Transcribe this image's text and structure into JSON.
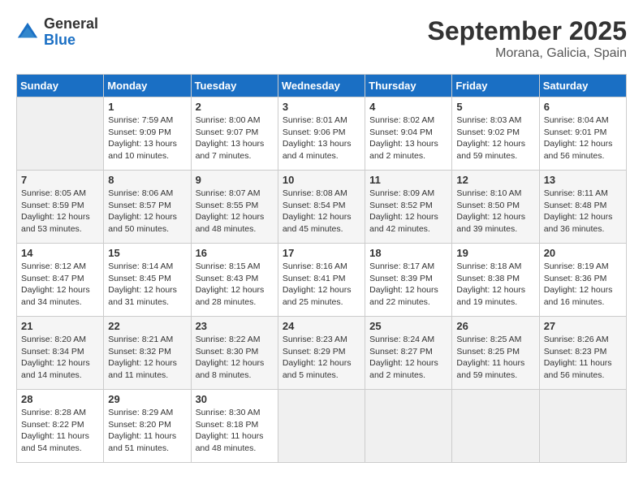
{
  "header": {
    "logo": {
      "general": "General",
      "blue": "Blue"
    },
    "title": "September 2025",
    "location": "Morana, Galicia, Spain"
  },
  "calendar": {
    "weekdays": [
      "Sunday",
      "Monday",
      "Tuesday",
      "Wednesday",
      "Thursday",
      "Friday",
      "Saturday"
    ],
    "weeks": [
      [
        {
          "day": "",
          "sunrise": "",
          "sunset": "",
          "daylight": ""
        },
        {
          "day": "1",
          "sunrise": "Sunrise: 7:59 AM",
          "sunset": "Sunset: 9:09 PM",
          "daylight": "Daylight: 13 hours and 10 minutes."
        },
        {
          "day": "2",
          "sunrise": "Sunrise: 8:00 AM",
          "sunset": "Sunset: 9:07 PM",
          "daylight": "Daylight: 13 hours and 7 minutes."
        },
        {
          "day": "3",
          "sunrise": "Sunrise: 8:01 AM",
          "sunset": "Sunset: 9:06 PM",
          "daylight": "Daylight: 13 hours and 4 minutes."
        },
        {
          "day": "4",
          "sunrise": "Sunrise: 8:02 AM",
          "sunset": "Sunset: 9:04 PM",
          "daylight": "Daylight: 13 hours and 2 minutes."
        },
        {
          "day": "5",
          "sunrise": "Sunrise: 8:03 AM",
          "sunset": "Sunset: 9:02 PM",
          "daylight": "Daylight: 12 hours and 59 minutes."
        },
        {
          "day": "6",
          "sunrise": "Sunrise: 8:04 AM",
          "sunset": "Sunset: 9:01 PM",
          "daylight": "Daylight: 12 hours and 56 minutes."
        }
      ],
      [
        {
          "day": "7",
          "sunrise": "Sunrise: 8:05 AM",
          "sunset": "Sunset: 8:59 PM",
          "daylight": "Daylight: 12 hours and 53 minutes."
        },
        {
          "day": "8",
          "sunrise": "Sunrise: 8:06 AM",
          "sunset": "Sunset: 8:57 PM",
          "daylight": "Daylight: 12 hours and 50 minutes."
        },
        {
          "day": "9",
          "sunrise": "Sunrise: 8:07 AM",
          "sunset": "Sunset: 8:55 PM",
          "daylight": "Daylight: 12 hours and 48 minutes."
        },
        {
          "day": "10",
          "sunrise": "Sunrise: 8:08 AM",
          "sunset": "Sunset: 8:54 PM",
          "daylight": "Daylight: 12 hours and 45 minutes."
        },
        {
          "day": "11",
          "sunrise": "Sunrise: 8:09 AM",
          "sunset": "Sunset: 8:52 PM",
          "daylight": "Daylight: 12 hours and 42 minutes."
        },
        {
          "day": "12",
          "sunrise": "Sunrise: 8:10 AM",
          "sunset": "Sunset: 8:50 PM",
          "daylight": "Daylight: 12 hours and 39 minutes."
        },
        {
          "day": "13",
          "sunrise": "Sunrise: 8:11 AM",
          "sunset": "Sunset: 8:48 PM",
          "daylight": "Daylight: 12 hours and 36 minutes."
        }
      ],
      [
        {
          "day": "14",
          "sunrise": "Sunrise: 8:12 AM",
          "sunset": "Sunset: 8:47 PM",
          "daylight": "Daylight: 12 hours and 34 minutes."
        },
        {
          "day": "15",
          "sunrise": "Sunrise: 8:14 AM",
          "sunset": "Sunset: 8:45 PM",
          "daylight": "Daylight: 12 hours and 31 minutes."
        },
        {
          "day": "16",
          "sunrise": "Sunrise: 8:15 AM",
          "sunset": "Sunset: 8:43 PM",
          "daylight": "Daylight: 12 hours and 28 minutes."
        },
        {
          "day": "17",
          "sunrise": "Sunrise: 8:16 AM",
          "sunset": "Sunset: 8:41 PM",
          "daylight": "Daylight: 12 hours and 25 minutes."
        },
        {
          "day": "18",
          "sunrise": "Sunrise: 8:17 AM",
          "sunset": "Sunset: 8:39 PM",
          "daylight": "Daylight: 12 hours and 22 minutes."
        },
        {
          "day": "19",
          "sunrise": "Sunrise: 8:18 AM",
          "sunset": "Sunset: 8:38 PM",
          "daylight": "Daylight: 12 hours and 19 minutes."
        },
        {
          "day": "20",
          "sunrise": "Sunrise: 8:19 AM",
          "sunset": "Sunset: 8:36 PM",
          "daylight": "Daylight: 12 hours and 16 minutes."
        }
      ],
      [
        {
          "day": "21",
          "sunrise": "Sunrise: 8:20 AM",
          "sunset": "Sunset: 8:34 PM",
          "daylight": "Daylight: 12 hours and 14 minutes."
        },
        {
          "day": "22",
          "sunrise": "Sunrise: 8:21 AM",
          "sunset": "Sunset: 8:32 PM",
          "daylight": "Daylight: 12 hours and 11 minutes."
        },
        {
          "day": "23",
          "sunrise": "Sunrise: 8:22 AM",
          "sunset": "Sunset: 8:30 PM",
          "daylight": "Daylight: 12 hours and 8 minutes."
        },
        {
          "day": "24",
          "sunrise": "Sunrise: 8:23 AM",
          "sunset": "Sunset: 8:29 PM",
          "daylight": "Daylight: 12 hours and 5 minutes."
        },
        {
          "day": "25",
          "sunrise": "Sunrise: 8:24 AM",
          "sunset": "Sunset: 8:27 PM",
          "daylight": "Daylight: 12 hours and 2 minutes."
        },
        {
          "day": "26",
          "sunrise": "Sunrise: 8:25 AM",
          "sunset": "Sunset: 8:25 PM",
          "daylight": "Daylight: 11 hours and 59 minutes."
        },
        {
          "day": "27",
          "sunrise": "Sunrise: 8:26 AM",
          "sunset": "Sunset: 8:23 PM",
          "daylight": "Daylight: 11 hours and 56 minutes."
        }
      ],
      [
        {
          "day": "28",
          "sunrise": "Sunrise: 8:28 AM",
          "sunset": "Sunset: 8:22 PM",
          "daylight": "Daylight: 11 hours and 54 minutes."
        },
        {
          "day": "29",
          "sunrise": "Sunrise: 8:29 AM",
          "sunset": "Sunset: 8:20 PM",
          "daylight": "Daylight: 11 hours and 51 minutes."
        },
        {
          "day": "30",
          "sunrise": "Sunrise: 8:30 AM",
          "sunset": "Sunset: 8:18 PM",
          "daylight": "Daylight: 11 hours and 48 minutes."
        },
        {
          "day": "",
          "sunrise": "",
          "sunset": "",
          "daylight": ""
        },
        {
          "day": "",
          "sunrise": "",
          "sunset": "",
          "daylight": ""
        },
        {
          "day": "",
          "sunrise": "",
          "sunset": "",
          "daylight": ""
        },
        {
          "day": "",
          "sunrise": "",
          "sunset": "",
          "daylight": ""
        }
      ]
    ]
  }
}
